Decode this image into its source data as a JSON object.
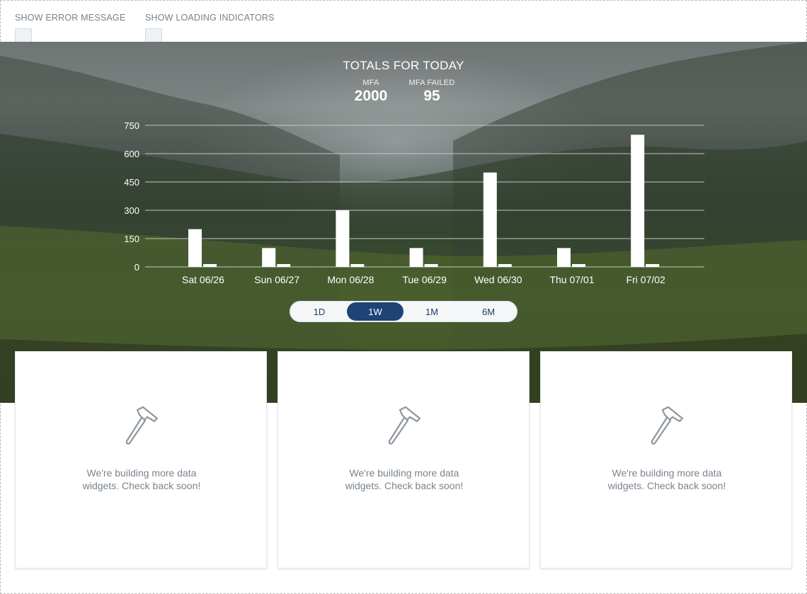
{
  "toggles": [
    {
      "label": "SHOW ERROR MESSAGE",
      "checked": false
    },
    {
      "label": "SHOW LOADING INDICATORS",
      "checked": false
    }
  ],
  "totals": {
    "title": "TOTALS FOR TODAY",
    "stats": [
      {
        "label": "MFA",
        "value": "2000"
      },
      {
        "label": "MFA FAILED",
        "value": "95"
      }
    ]
  },
  "chart_data": {
    "type": "bar",
    "categories": [
      "Sat 06/26",
      "Sun 06/27",
      "Mon 06/28",
      "Tue 06/29",
      "Wed 06/30",
      "Thu 07/01",
      "Fri 07/02"
    ],
    "series": [
      {
        "values": [
          200,
          100,
          300,
          100,
          500,
          100,
          700
        ]
      },
      {
        "values": [
          15,
          15,
          15,
          15,
          15,
          15,
          15
        ]
      }
    ],
    "yticks": [
      0,
      150,
      300,
      450,
      600,
      750
    ],
    "ylim": [
      0,
      750
    ],
    "grid": true,
    "bar_color": "#ffffff",
    "grid_color": "#c9cdc9"
  },
  "range_selector": {
    "options": [
      "1D",
      "1W",
      "1M",
      "6M"
    ],
    "selected": "1W"
  },
  "cards": [
    {
      "icon": "hammer-icon",
      "line1": "We're building more data",
      "line2": "widgets. Check back soon!"
    },
    {
      "icon": "hammer-icon",
      "line1": "We're building more data",
      "line2": "widgets. Check back soon!"
    },
    {
      "icon": "hammer-icon",
      "line1": "We're building more data",
      "line2": "widgets. Check back soon!"
    }
  ],
  "colors": {
    "accent": "#1e4374",
    "muted_text": "#7a848e"
  }
}
